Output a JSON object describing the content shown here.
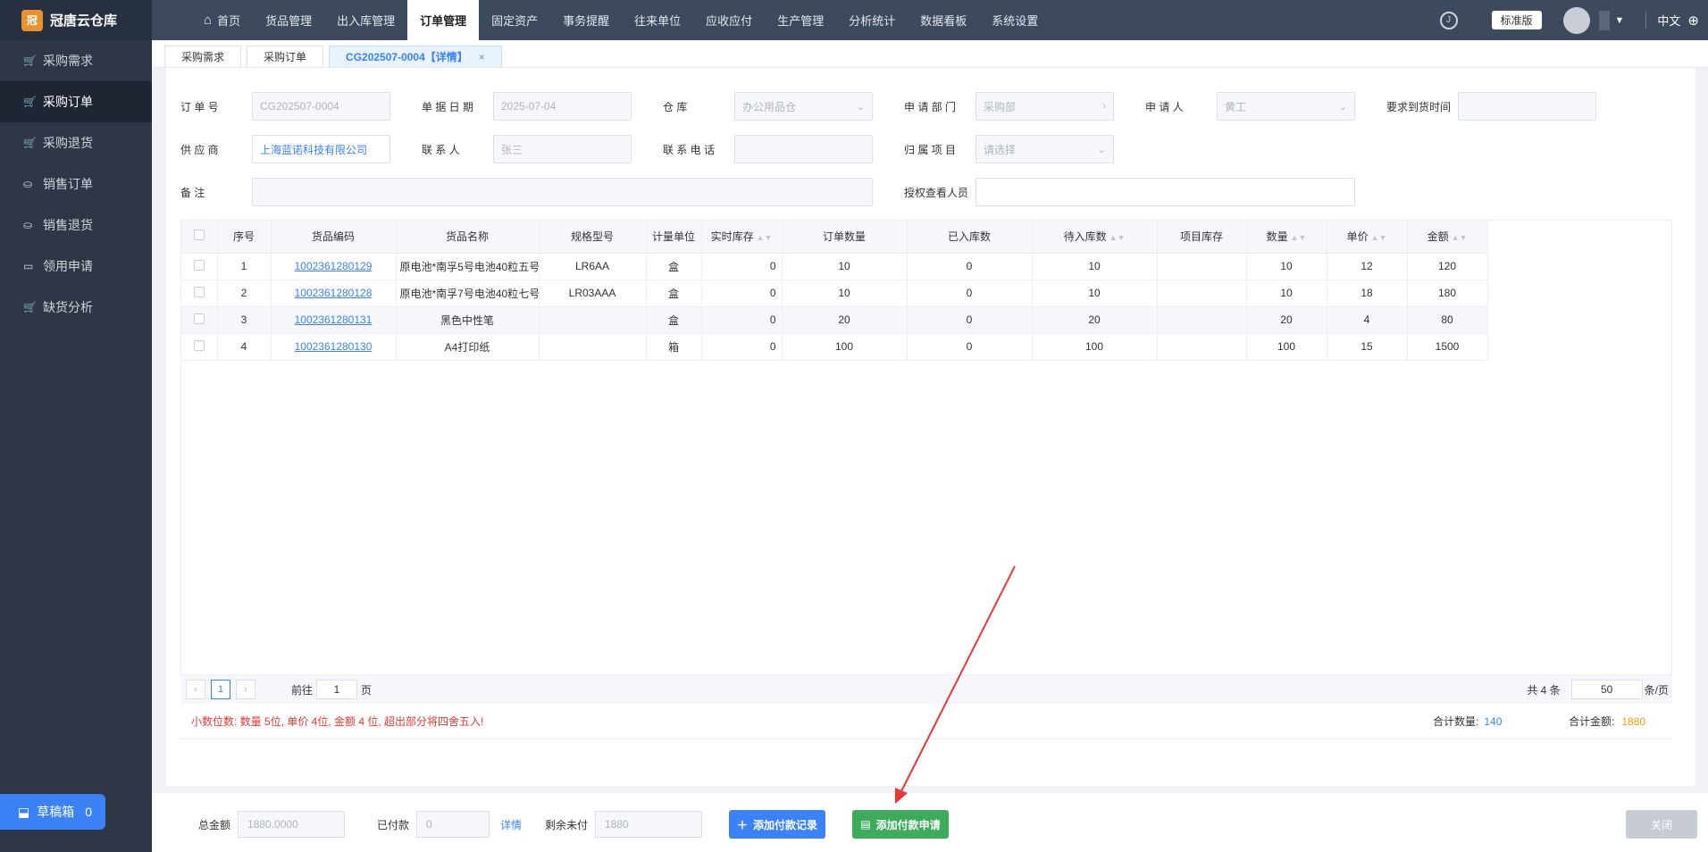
{
  "app": {
    "name": "冠唐云仓库",
    "logo_char": "冠"
  },
  "sidebar": {
    "items": [
      {
        "label": "采购需求",
        "icon": "cart-icon",
        "active": false
      },
      {
        "label": "采购订单",
        "icon": "cart-icon",
        "active": true
      },
      {
        "label": "采购退货",
        "icon": "cart-icon",
        "active": false
      },
      {
        "label": "销售订单",
        "icon": "bag-icon",
        "active": false
      },
      {
        "label": "销售退货",
        "icon": "bag-icon",
        "active": false
      },
      {
        "label": "领用申请",
        "icon": "box-icon",
        "active": false
      },
      {
        "label": "缺货分析",
        "icon": "cart-icon",
        "active": false
      }
    ],
    "draft": {
      "label": "草稿箱",
      "count": "0"
    }
  },
  "topnav": {
    "items": [
      "首页",
      "货品管理",
      "出入库管理",
      "订单管理",
      "固定资产",
      "事务提醒",
      "往来单位",
      "应收应付",
      "生产管理",
      "分析统计",
      "数据看板",
      "系统设置"
    ],
    "active_index": 3,
    "edition": "标准版",
    "lang": "中文"
  },
  "tabs": [
    {
      "label": "采购需求"
    },
    {
      "label": "采购订单"
    },
    {
      "label": "CG202507-0004【详情】",
      "active": true
    }
  ],
  "form": {
    "order_no": {
      "label": "订 单 号",
      "value": "CG202507-0004"
    },
    "doc_date": {
      "label": "单 据 日 期",
      "value": "2025-07-04"
    },
    "warehouse": {
      "label": "仓 库",
      "value": "办公用品仓"
    },
    "dept": {
      "label": "申 请 部 门",
      "value": "采购部"
    },
    "applicant": {
      "label": "申 请 人",
      "value": "黄工"
    },
    "arrival": {
      "label": "要求到货时间",
      "value": ""
    },
    "supplier": {
      "label": "供 应 商",
      "value": "上海蓝诺科技有限公司"
    },
    "contact": {
      "label": "联 系 人",
      "value": "张三"
    },
    "phone": {
      "label": "联 系 电 话",
      "value": ""
    },
    "project": {
      "label": "归 属 项 目",
      "value": "请选择"
    },
    "remark": {
      "label": "备 注",
      "value": ""
    },
    "viewers": {
      "label": "授权查看人员",
      "value": ""
    }
  },
  "table": {
    "headers": [
      "序号",
      "货品编码",
      "货品名称",
      "规格型号",
      "计量单位",
      "实时库存",
      "订单数量",
      "已入库数",
      "待入库数",
      "项目库存",
      "数量",
      "单价",
      "金额"
    ],
    "rows": [
      [
        "1",
        "1002361280129",
        "原电池*南孚5号电池40粒五号",
        "LR6AA",
        "盒",
        "0",
        "10",
        "0",
        "10",
        "",
        "10",
        "12",
        "120"
      ],
      [
        "2",
        "1002361280128",
        "原电池*南孚7号电池40粒七号",
        "LR03AAA",
        "盒",
        "0",
        "10",
        "0",
        "10",
        "",
        "10",
        "18",
        "180"
      ],
      [
        "3",
        "1002361280131",
        "黑色中性笔",
        "",
        "盒",
        "0",
        "20",
        "0",
        "20",
        "",
        "20",
        "4",
        "80"
      ],
      [
        "4",
        "1002361280130",
        "A4打印纸",
        "",
        "箱",
        "0",
        "100",
        "0",
        "100",
        "",
        "100",
        "15",
        "1500"
      ]
    ]
  },
  "pager": {
    "current": "1",
    "goto_label": "前往",
    "goto_value": "1",
    "page_unit": "页",
    "total": "共 4 条",
    "size": "50",
    "size_unit": "条/页"
  },
  "summary": {
    "note": "小数位数: 数量 5位, 单价 4位, 金额 4 位, 超出部分将四舍五入!",
    "qty_label": "合计数量:",
    "qty": "140",
    "amt_label": "合计金额:",
    "amt": "1880"
  },
  "footer": {
    "total_label": "总金额",
    "total": "1880.0000",
    "paid_label": "已付款",
    "paid": "0",
    "detail": "详情",
    "unpaid_label": "剩余未付",
    "unpaid": "1880",
    "btn_add_record": "添加付款记录",
    "btn_add_request": "添加付款申请",
    "btn_close": "关闭"
  },
  "colors": {
    "accent": "#3b82f6",
    "green": "#3daa5c",
    "sidebar": "#2f3747",
    "topnav": "#3d4a5e",
    "arrow": "#e53935"
  }
}
